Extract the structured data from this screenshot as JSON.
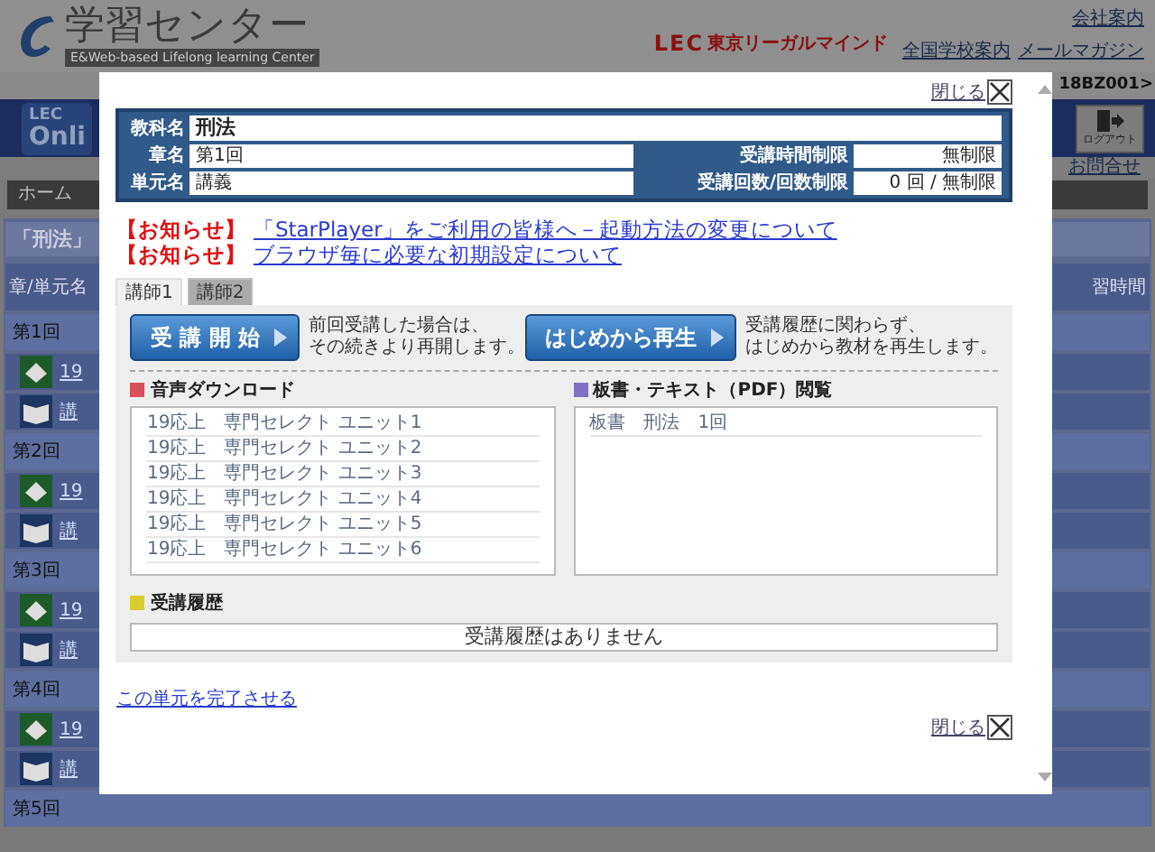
{
  "header": {
    "logo_title": "学習センター",
    "logo_subtitle": "E&Web-based Lifelong learning Center",
    "brand_mark": "LEC",
    "brand": "東京リーガルマインド",
    "links": [
      "会社案内",
      "全国学校案内",
      "メールマガジン"
    ]
  },
  "user_code": "18BZ001>",
  "nav": {
    "logo_top": "LEC",
    "logo_bottom": "Onli",
    "logout": "ログアウト"
  },
  "contact": "お問合せ",
  "breadcrumb": "ホーム",
  "course_title": "「刑法」",
  "table": {
    "column_1": "章/単元名",
    "column_last": "習時間"
  },
  "sections": [
    {
      "title": "第1回",
      "items": [
        {
          "kind": "test",
          "text": "19"
        },
        {
          "kind": "lecture",
          "text": "講"
        }
      ]
    },
    {
      "title": "第2回",
      "items": [
        {
          "kind": "test",
          "text": "19"
        },
        {
          "kind": "lecture",
          "text": "講"
        }
      ]
    },
    {
      "title": "第3回",
      "items": [
        {
          "kind": "test",
          "text": "19"
        },
        {
          "kind": "lecture",
          "text": "講"
        }
      ]
    },
    {
      "title": "第4回",
      "items": [
        {
          "kind": "test",
          "text": "19"
        },
        {
          "kind": "lecture",
          "text": "講"
        }
      ]
    },
    {
      "title": "第5回"
    }
  ],
  "modal": {
    "close_label": "閉じる",
    "info": {
      "subject_label": "教科名",
      "subject": "刑法",
      "chapter_label": "章名",
      "chapter": "第1回",
      "unit_label": "単元名",
      "unit": "講義",
      "time_limit_label": "受講時間制限",
      "time_limit": "無制限",
      "count_label": "受講回数/回数制限",
      "count": "0 回 / 無制限"
    },
    "notices": [
      {
        "tag": "【お知らせ】",
        "link": "「StarPlayer」をご利用の皆様へ－起動方法の変更について"
      },
      {
        "tag": "【お知らせ】",
        "link": "ブラウザ毎に必要な初期設定について"
      }
    ],
    "tabs": [
      {
        "label": "講師1",
        "selected": true
      },
      {
        "label": "講師2",
        "selected": false
      }
    ],
    "actions": [
      {
        "label": "受 講 開 始",
        "description": [
          "前回受講した場合は、",
          "その続きより再開します。"
        ]
      },
      {
        "label": "はじめから再生",
        "description": [
          "受講履歴に関わらず、",
          "はじめから教材を再生します。"
        ]
      }
    ],
    "audio": {
      "title": "音声ダウンロード",
      "items": [
        "19応上　専門セレクト ユニット1",
        "19応上　専門セレクト ユニット2",
        "19応上　専門セレクト ユニット3",
        "19応上　専門セレクト ユニット4",
        "19応上　専門セレクト ユニット5",
        "19応上　専門セレクト ユニット6"
      ]
    },
    "text": {
      "title": "板書・テキスト（PDF）閲覧",
      "items": [
        "板書　刑法　1回"
      ]
    },
    "history": {
      "title": "受講履歴",
      "message": "受講履歴はありません"
    },
    "complete_link": "この単元を完了させる",
    "close_label_bottom": "閉じる"
  }
}
